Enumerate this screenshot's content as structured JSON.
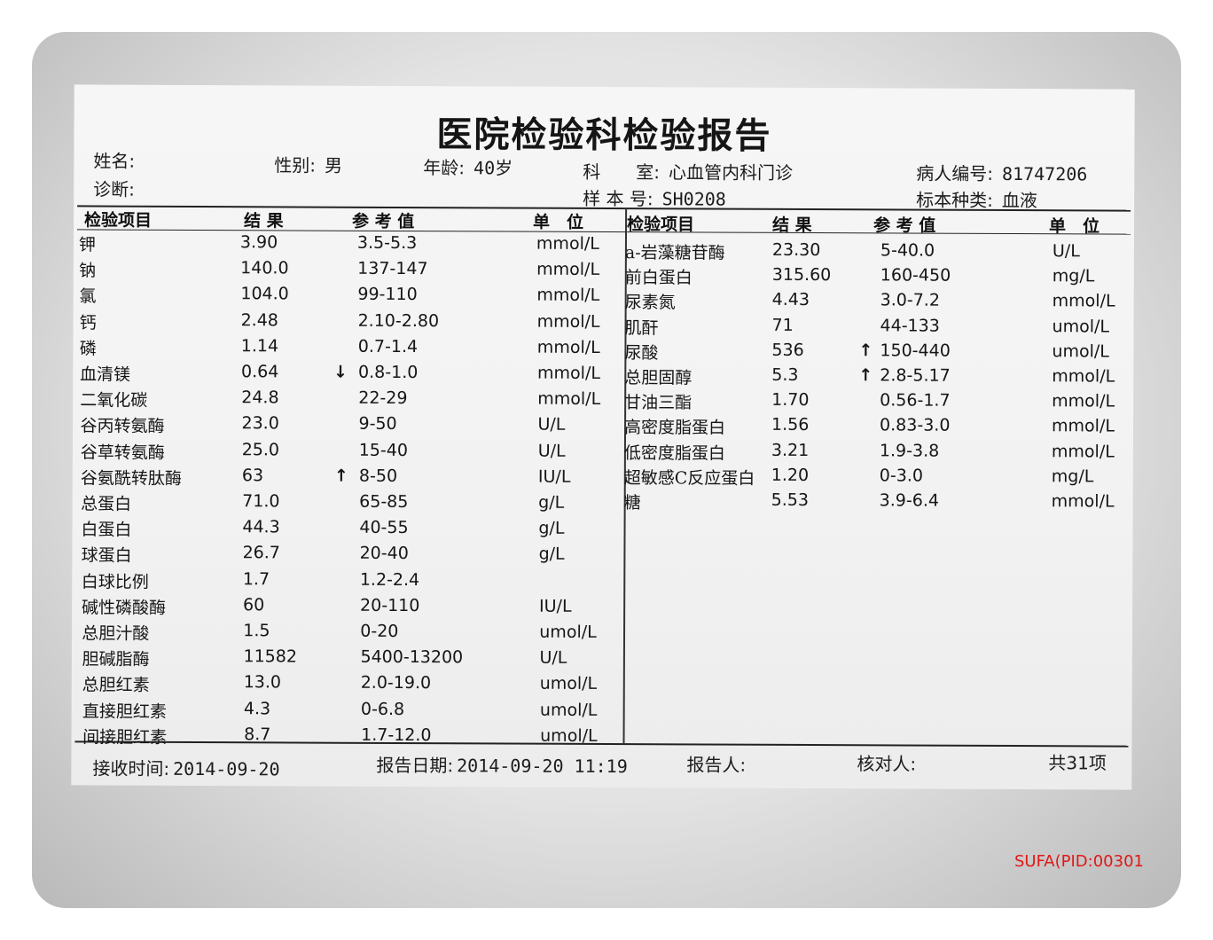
{
  "report": {
    "title": "医院检验科检验报告",
    "header": {
      "name_label": "姓名:",
      "name_value": "",
      "sex_label": "性别:",
      "sex_value": "男",
      "age_label": "年龄:",
      "age_value": "40岁",
      "dept_label": "科　　室:",
      "dept_value": "心血管内科门诊",
      "patient_id_label": "病人编号:",
      "patient_id_value": "81747206",
      "diagnosis_label": "诊断:",
      "sample_no_label": "样 本 号:",
      "sample_no_value": "SH0208",
      "sample_type_label": "标本种类:",
      "sample_type_value": "血液"
    },
    "columns": {
      "item": "检验项目",
      "result": "结 果",
      "reference": "参 考 值",
      "unit": "单　位"
    },
    "left_rows": [
      {
        "item": "钾",
        "result": "3.90",
        "flag": "",
        "reference": "3.5-5.3",
        "unit": "mmol/L"
      },
      {
        "item": "钠",
        "result": "140.0",
        "flag": "",
        "reference": "137-147",
        "unit": "mmol/L"
      },
      {
        "item": "氯",
        "result": "104.0",
        "flag": "",
        "reference": "99-110",
        "unit": "mmol/L"
      },
      {
        "item": "钙",
        "result": "2.48",
        "flag": "",
        "reference": "2.10-2.80",
        "unit": "mmol/L"
      },
      {
        "item": "磷",
        "result": "1.14",
        "flag": "",
        "reference": "0.7-1.4",
        "unit": "mmol/L"
      },
      {
        "item": "血清镁",
        "result": "0.64",
        "flag": "↓",
        "reference": "0.8-1.0",
        "unit": "mmol/L"
      },
      {
        "item": "二氧化碳",
        "result": "24.8",
        "flag": "",
        "reference": "22-29",
        "unit": "mmol/L"
      },
      {
        "item": "谷丙转氨酶",
        "result": "23.0",
        "flag": "",
        "reference": "9-50",
        "unit": "U/L"
      },
      {
        "item": "谷草转氨酶",
        "result": "25.0",
        "flag": "",
        "reference": "15-40",
        "unit": "U/L"
      },
      {
        "item": "谷氨酰转肽酶",
        "result": "63",
        "flag": "↑",
        "reference": "8-50",
        "unit": "IU/L"
      },
      {
        "item": "总蛋白",
        "result": "71.0",
        "flag": "",
        "reference": "65-85",
        "unit": "g/L"
      },
      {
        "item": "白蛋白",
        "result": "44.3",
        "flag": "",
        "reference": "40-55",
        "unit": "g/L"
      },
      {
        "item": "球蛋白",
        "result": "26.7",
        "flag": "",
        "reference": "20-40",
        "unit": "g/L"
      },
      {
        "item": "白球比例",
        "result": "1.7",
        "flag": "",
        "reference": "1.2-2.4",
        "unit": ""
      },
      {
        "item": "碱性磷酸酶",
        "result": "60",
        "flag": "",
        "reference": "20-110",
        "unit": "IU/L"
      },
      {
        "item": "总胆汁酸",
        "result": "1.5",
        "flag": "",
        "reference": "0-20",
        "unit": "umol/L"
      },
      {
        "item": "胆碱脂酶",
        "result": "11582",
        "flag": "",
        "reference": "5400-13200",
        "unit": "U/L"
      },
      {
        "item": "总胆红素",
        "result": "13.0",
        "flag": "",
        "reference": "2.0-19.0",
        "unit": "umol/L"
      },
      {
        "item": "直接胆红素",
        "result": "4.3",
        "flag": "",
        "reference": "0-6.8",
        "unit": "umol/L"
      },
      {
        "item": "间接胆红素",
        "result": "8.7",
        "flag": "",
        "reference": "1.7-12.0",
        "unit": "umol/L"
      }
    ],
    "right_rows": [
      {
        "item": "a-岩藻糖苷酶",
        "result": "23.30",
        "flag": "",
        "reference": "5-40.0",
        "unit": "U/L"
      },
      {
        "item": "前白蛋白",
        "result": "315.60",
        "flag": "",
        "reference": "160-450",
        "unit": "mg/L"
      },
      {
        "item": "尿素氮",
        "result": "4.43",
        "flag": "",
        "reference": "3.0-7.2",
        "unit": "mmol/L"
      },
      {
        "item": "肌酐",
        "result": "71",
        "flag": "",
        "reference": "44-133",
        "unit": "umol/L"
      },
      {
        "item": "尿酸",
        "result": "536",
        "flag": "↑",
        "reference": "150-440",
        "unit": "umol/L"
      },
      {
        "item": "总胆固醇",
        "result": "5.3",
        "flag": "↑",
        "reference": "2.8-5.17",
        "unit": "mmol/L"
      },
      {
        "item": "甘油三酯",
        "result": "1.70",
        "flag": "",
        "reference": "0.56-1.7",
        "unit": "mmol/L"
      },
      {
        "item": "高密度脂蛋白",
        "result": "1.56",
        "flag": "",
        "reference": "0.83-3.0",
        "unit": "mmol/L"
      },
      {
        "item": "低密度脂蛋白",
        "result": "3.21",
        "flag": "",
        "reference": "1.9-3.8",
        "unit": "mmol/L"
      },
      {
        "item": "超敏感C反应蛋白",
        "result": "1.20",
        "flag": "",
        "reference": "0-3.0",
        "unit": "mg/L"
      },
      {
        "item": "糖",
        "result": "5.53",
        "flag": "",
        "reference": "3.9-6.4",
        "unit": "mmol/L"
      }
    ],
    "footer": {
      "received_label": "接收时间:",
      "received_value": "2014-09-20",
      "report_date_label": "报告日期:",
      "report_date_value": "2014-09-20 11:19",
      "reporter_label": "报告人:",
      "checker_label": "核对人:",
      "total": "共31项"
    }
  },
  "watermark": "SUFA(PID:00301"
}
